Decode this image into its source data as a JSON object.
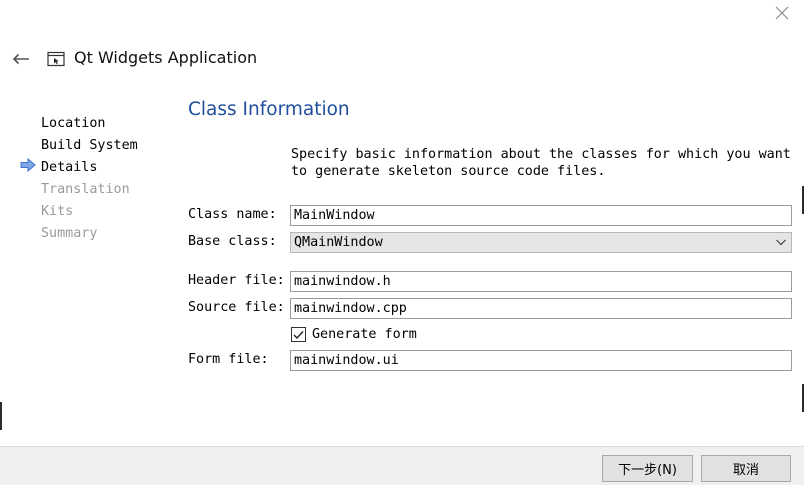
{
  "window": {
    "title": "Qt Widgets Application",
    "close_icon": "close-icon",
    "back_icon": "back-arrow-icon",
    "app_icon": "qt-widgets-app-icon"
  },
  "steps": [
    {
      "label": "Location",
      "state": "done"
    },
    {
      "label": "Build System",
      "state": "done"
    },
    {
      "label": "Details",
      "state": "current"
    },
    {
      "label": "Translation",
      "state": "pending"
    },
    {
      "label": "Kits",
      "state": "pending"
    },
    {
      "label": "Summary",
      "state": "pending"
    }
  ],
  "page": {
    "title": "Class Information",
    "description": "Specify basic information about the classes for which you want to generate skeleton source code files."
  },
  "form": {
    "class_name_label": "Class name:",
    "class_name_value": "MainWindow",
    "base_class_label": "Base class:",
    "base_class_value": "QMainWindow",
    "header_file_label": "Header file:",
    "header_file_value": "mainwindow.h",
    "source_file_label": "Source file:",
    "source_file_value": "mainwindow.cpp",
    "generate_form_label": "Generate form",
    "generate_form_checked": true,
    "form_file_label": "Form file:",
    "form_file_value": "mainwindow.ui"
  },
  "buttons": {
    "next_label": "下一步(N)",
    "cancel_label": "取消"
  },
  "colors": {
    "section_title": "#1f4f9b",
    "current_step_arrow": "#4a7fd4",
    "pending_step": "#9a9a9a"
  }
}
